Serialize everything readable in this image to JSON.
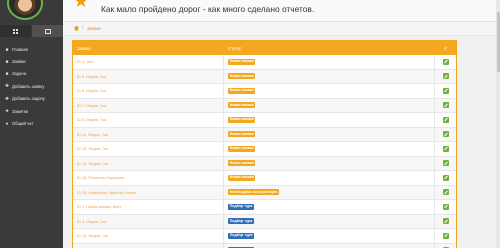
{
  "sidebar": {
    "avatar_icon": "user-avatar",
    "items": [
      {
        "icon": "home-icon",
        "glyph": "■",
        "label": "Главная"
      },
      {
        "icon": "tasks-icon",
        "glyph": "■",
        "label": "Заявки"
      },
      {
        "icon": "task-icon",
        "glyph": "■",
        "label": "Задача"
      },
      {
        "icon": "plus-icon",
        "glyph": "✚",
        "label": "Добавить заявку"
      },
      {
        "icon": "plus-icon",
        "glyph": "✚",
        "label": "Добавить задачу"
      },
      {
        "icon": "star-icon",
        "glyph": "★",
        "label": "Заметки"
      },
      {
        "icon": "chat-icon",
        "glyph": "●",
        "label": "Общий чат"
      }
    ]
  },
  "header": {
    "title": "Как мало пройдено дорог - как много сделано отчетов."
  },
  "breadcrumb": {
    "current": "Заявки"
  },
  "table": {
    "columns": [
      "Заявка",
      "Статус",
      "#"
    ],
    "rows": [
      {
        "title": "ID 2, тест",
        "status": "Новая заявка",
        "badge_color": "#f3a81f"
      },
      {
        "title": "ID 5, Индия, Гоа",
        "status": "Новая заявка",
        "badge_color": "#f3a81f"
      },
      {
        "title": "ID 6, Индия, Гоа",
        "status": "Новая заявка",
        "badge_color": "#f3a81f"
      },
      {
        "title": "ID 7, Индия, Гоа",
        "status": "Новая заявка",
        "badge_color": "#f3a81f"
      },
      {
        "title": "ID 8, Индия, Гоа",
        "status": "Новая заявка",
        "badge_color": "#f3a81f"
      },
      {
        "title": "ID 11, Индия, Гоа",
        "status": "Новая заявка",
        "badge_color": "#f3a81f"
      },
      {
        "title": "ID 12, Индия, Гоа",
        "status": "Новая заявка",
        "badge_color": "#f3a81f"
      },
      {
        "title": "ID 15, Индия, Гоа",
        "status": "Новая заявка",
        "badge_color": "#f3a81f"
      },
      {
        "title": "ID 18, Египет/из Харькова",
        "status": "Новая заявка",
        "badge_color": "#f3a81f"
      },
      {
        "title": "ID 20, Мальта/из Праги/из Чехии",
        "status": "Необходима консультация",
        "badge_color": "#f3a81f"
      },
      {
        "title": "ID 1, Новая заявка, Крит",
        "status": "Подбор тура",
        "badge_color": "#2f6fb8"
      },
      {
        "title": "ID 4, Индия, Гоа",
        "status": "Подбор тура",
        "badge_color": "#2f6fb8"
      },
      {
        "title": "ID 10, Индия, Гоа",
        "status": "Подбор тура",
        "badge_color": "#2f6fb8"
      },
      {
        "title": "ID 13, Индия, Гоа",
        "status": "Подбор тура",
        "badge_color": "#2f6fb8"
      }
    ]
  },
  "colors": {
    "accent": "#f3a81f",
    "sidebar_bg": "#3a3a3a",
    "edit_button": "#72b33f",
    "status_blue": "#2f6fb8"
  }
}
